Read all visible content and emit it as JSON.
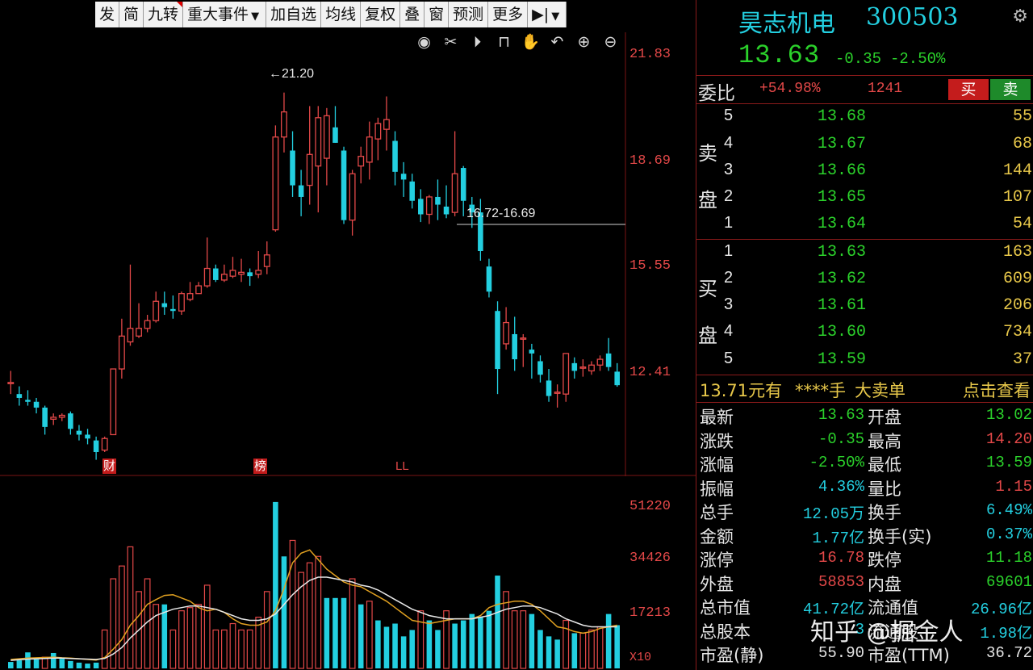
{
  "toolbar": {
    "buttons": [
      "发",
      "简",
      "九转",
      "重大事件",
      "加自选",
      "均线",
      "复权",
      "叠",
      "窗",
      "预测",
      "更多"
    ]
  },
  "icons": [
    "eye-icon",
    "scissors-icon",
    "play-circle-icon",
    "lock-icon",
    "hand-icon",
    "undo-icon",
    "zoom-in-icon",
    "zoom-out-icon"
  ],
  "kline": {
    "price_axis": [
      "21.83",
      "18.69",
      "15.55",
      "12.41"
    ],
    "high_annotation": "21.20",
    "gap_annotation": "16.72-16.69",
    "markers": {
      "cai": "财",
      "bang": "榜",
      "ll": "LL"
    }
  },
  "volume": {
    "axis": [
      "51220",
      "34426",
      "17213"
    ],
    "unit": "X10"
  },
  "quote": {
    "name": "昊志机电",
    "code": "300503",
    "price": "13.63",
    "change": "-0.35",
    "change_pct": "-2.50%",
    "ratio_label": "委比",
    "ratio_pct": "+54.98%",
    "ratio_diff": "1241",
    "buy_label": "买",
    "sell_label": "卖",
    "sell_side_label": [
      "卖",
      "盘"
    ],
    "buy_side_label": [
      "买",
      "盘"
    ],
    "asks": [
      {
        "level": "5",
        "price": "13.68",
        "vol": "55"
      },
      {
        "level": "4",
        "price": "13.67",
        "vol": "68"
      },
      {
        "level": "3",
        "price": "13.66",
        "vol": "144"
      },
      {
        "level": "2",
        "price": "13.65",
        "vol": "107"
      },
      {
        "level": "1",
        "price": "13.64",
        "vol": "54"
      }
    ],
    "bids": [
      {
        "level": "1",
        "price": "13.63",
        "vol": "163"
      },
      {
        "level": "2",
        "price": "13.62",
        "vol": "609"
      },
      {
        "level": "3",
        "price": "13.61",
        "vol": "206"
      },
      {
        "level": "4",
        "price": "13.60",
        "vol": "734"
      },
      {
        "level": "5",
        "price": "13.59",
        "vol": "37"
      }
    ],
    "big_order": {
      "price": "13.71元有",
      "hands": "****手",
      "label": "大卖单",
      "link": "点击查看"
    },
    "stats": [
      {
        "l1": "最新",
        "v1": "13.63",
        "c1": "green",
        "l2": "开盘",
        "v2": "13.02",
        "c2": "green"
      },
      {
        "l1": "涨跌",
        "v1": "-0.35",
        "c1": "green",
        "l2": "最高",
        "v2": "14.20",
        "c2": "red"
      },
      {
        "l1": "涨幅",
        "v1": "-2.50%",
        "c1": "green",
        "l2": "最低",
        "v2": "13.59",
        "c2": "green"
      },
      {
        "l1": "振幅",
        "v1": "4.36%",
        "c1": "cyan",
        "l2": "量比",
        "v2": "1.15",
        "c2": "red"
      },
      {
        "l1": "总手",
        "v1": "12.05万",
        "c1": "cyan",
        "l2": "换手",
        "v2": "6.49%",
        "c2": "cyan"
      },
      {
        "l1": "金额",
        "v1": "1.77亿",
        "c1": "cyan",
        "l2": "换手(实)",
        "v2": "0.37%",
        "c2": "cyan"
      },
      {
        "l1": "涨停",
        "v1": "16.78",
        "c1": "red",
        "l2": "跌停",
        "v2": "11.18",
        "c2": "green"
      },
      {
        "l1": "外盘",
        "v1": "58853",
        "c1": "red",
        "l2": "内盘",
        "v2": "69601",
        "c2": "green"
      },
      {
        "l1": "总市值",
        "v1": "41.72亿",
        "c1": "cyan",
        "l2": "流通值",
        "v2": "26.96亿",
        "c2": "cyan"
      },
      {
        "l1": "总股本",
        "v1": "3",
        "c1": "cyan",
        "l2": "流通股",
        "v2": "1.98亿",
        "c2": "cyan"
      },
      {
        "l1": "市盈(静)",
        "v1": "55.90",
        "c1": "white",
        "l2": "市盈(TTM)",
        "v2": "36.72",
        "c2": "white"
      }
    ]
  },
  "watermark": "知乎 @掘金人",
  "colors": {
    "up": "#e34848",
    "down": "#23cfe0",
    "price": "#2bd12b",
    "accent": "#e8c84a"
  },
  "chart_data": {
    "type": "candlestick",
    "title": "",
    "ylim": [
      11.9,
      22.3
    ],
    "candles": [
      {
        "o": 13.7,
        "c": 13.7,
        "h": 14.0,
        "l": 13.4
      },
      {
        "o": 13.4,
        "c": 13.3,
        "h": 13.6,
        "l": 13.1
      },
      {
        "o": 13.25,
        "c": 13.2,
        "h": 13.5,
        "l": 13.1
      },
      {
        "o": 13.2,
        "c": 13.05,
        "h": 13.3,
        "l": 12.9
      },
      {
        "o": 13.05,
        "c": 12.55,
        "h": 13.1,
        "l": 12.35
      },
      {
        "o": 12.75,
        "c": 12.8,
        "h": 12.9,
        "l": 12.6
      },
      {
        "o": 12.8,
        "c": 12.85,
        "h": 12.9,
        "l": 12.7
      },
      {
        "o": 12.9,
        "c": 12.5,
        "h": 12.95,
        "l": 12.35
      },
      {
        "o": 12.45,
        "c": 12.35,
        "h": 12.6,
        "l": 12.2
      },
      {
        "o": 12.35,
        "c": 12.25,
        "h": 12.5,
        "l": 12.1
      },
      {
        "o": 12.2,
        "c": 11.9,
        "h": 12.3,
        "l": 11.7
      },
      {
        "o": 11.95,
        "c": 12.25,
        "h": 12.3,
        "l": 11.9
      },
      {
        "o": 12.35,
        "c": 14.05,
        "h": 14.05,
        "l": 12.35
      },
      {
        "o": 14.05,
        "c": 14.9,
        "h": 15.35,
        "l": 13.8
      },
      {
        "o": 14.75,
        "c": 15.1,
        "h": 16.75,
        "l": 14.65
      },
      {
        "o": 14.9,
        "c": 15.1,
        "h": 15.75,
        "l": 14.85
      },
      {
        "o": 15.1,
        "c": 15.3,
        "h": 15.45,
        "l": 15.0
      },
      {
        "o": 15.3,
        "c": 15.8,
        "h": 16.05,
        "l": 15.25
      },
      {
        "o": 15.75,
        "c": 15.65,
        "h": 16.05,
        "l": 15.45
      },
      {
        "o": 15.6,
        "c": 15.55,
        "h": 15.95,
        "l": 15.35
      },
      {
        "o": 15.55,
        "c": 16.0,
        "h": 16.05,
        "l": 15.45
      },
      {
        "o": 15.85,
        "c": 16.0,
        "h": 16.3,
        "l": 15.8
      },
      {
        "o": 16.0,
        "c": 16.2,
        "h": 16.3,
        "l": 16.0
      },
      {
        "o": 16.2,
        "c": 16.65,
        "h": 17.45,
        "l": 16.15
      },
      {
        "o": 16.65,
        "c": 16.35,
        "h": 16.75,
        "l": 16.3
      },
      {
        "o": 16.35,
        "c": 16.5,
        "h": 16.75,
        "l": 16.3
      },
      {
        "o": 16.45,
        "c": 16.6,
        "h": 16.95,
        "l": 16.4
      },
      {
        "o": 16.5,
        "c": 16.55,
        "h": 16.9,
        "l": 16.3
      },
      {
        "o": 16.55,
        "c": 16.45,
        "h": 16.65,
        "l": 16.2
      },
      {
        "o": 16.5,
        "c": 16.6,
        "h": 17.1,
        "l": 16.4
      },
      {
        "o": 16.7,
        "c": 17.0,
        "h": 17.35,
        "l": 16.5
      },
      {
        "o": 17.65,
        "c": 20.05,
        "h": 20.35,
        "l": 17.6
      },
      {
        "o": 20.05,
        "c": 20.7,
        "h": 21.2,
        "l": 19.65
      },
      {
        "o": 19.7,
        "c": 18.8,
        "h": 20.2,
        "l": 18.5
      },
      {
        "o": 18.8,
        "c": 18.5,
        "h": 19.2,
        "l": 18.0
      },
      {
        "o": 18.8,
        "c": 19.6,
        "h": 20.85,
        "l": 18.3
      },
      {
        "o": 19.3,
        "c": 20.55,
        "h": 20.85,
        "l": 18.1
      },
      {
        "o": 19.5,
        "c": 20.6,
        "h": 20.8,
        "l": 18.8
      },
      {
        "o": 20.3,
        "c": 19.9,
        "h": 20.85,
        "l": 19.9
      },
      {
        "o": 19.7,
        "c": 17.9,
        "h": 19.8,
        "l": 17.8
      },
      {
        "o": 17.9,
        "c": 19.1,
        "h": 19.2,
        "l": 17.5
      },
      {
        "o": 19.3,
        "c": 19.55,
        "h": 19.8,
        "l": 18.85
      },
      {
        "o": 19.4,
        "c": 20.05,
        "h": 20.45,
        "l": 18.95
      },
      {
        "o": 20.0,
        "c": 20.4,
        "h": 20.55,
        "l": 19.45
      },
      {
        "o": 20.25,
        "c": 20.5,
        "h": 21.1,
        "l": 19.7
      },
      {
        "o": 19.95,
        "c": 19.15,
        "h": 20.2,
        "l": 18.8
      },
      {
        "o": 19.1,
        "c": 18.95,
        "h": 19.4,
        "l": 18.5
      },
      {
        "o": 18.9,
        "c": 18.4,
        "h": 19.1,
        "l": 18.2
      },
      {
        "o": 18.45,
        "c": 18.05,
        "h": 18.7,
        "l": 17.85
      },
      {
        "o": 18.05,
        "c": 18.5,
        "h": 18.55,
        "l": 17.8
      },
      {
        "o": 18.5,
        "c": 18.3,
        "h": 18.95,
        "l": 17.9
      },
      {
        "o": 18.25,
        "c": 18.05,
        "h": 18.8,
        "l": 17.95
      },
      {
        "o": 18.1,
        "c": 19.1,
        "h": 20.2,
        "l": 18.0
      },
      {
        "o": 19.25,
        "c": 18.4,
        "h": 19.3,
        "l": 18.0
      },
      {
        "o": 18.3,
        "c": 18.1,
        "h": 18.5,
        "l": 17.7
      },
      {
        "o": 18.1,
        "c": 17.1,
        "h": 18.45,
        "l": 16.85
      },
      {
        "o": 16.7,
        "c": 16.05,
        "h": 16.9,
        "l": 15.9
      },
      {
        "o": 15.55,
        "c": 14.05,
        "h": 15.8,
        "l": 13.4
      },
      {
        "o": 14.7,
        "c": 15.25,
        "h": 15.65,
        "l": 14.55
      },
      {
        "o": 14.95,
        "c": 14.3,
        "h": 15.4,
        "l": 14.0
      },
      {
        "o": 14.85,
        "c": 14.85,
        "h": 14.95,
        "l": 14.1
      },
      {
        "o": 14.55,
        "c": 14.45,
        "h": 14.7,
        "l": 13.8
      },
      {
        "o": 14.25,
        "c": 13.9,
        "h": 14.4,
        "l": 13.7
      },
      {
        "o": 13.75,
        "c": 13.35,
        "h": 14.05,
        "l": 13.2
      },
      {
        "o": 13.45,
        "c": 13.45,
        "h": 13.65,
        "l": 13.05
      },
      {
        "o": 13.4,
        "c": 14.45,
        "h": 14.45,
        "l": 13.2
      },
      {
        "o": 14.2,
        "c": 14.0,
        "h": 14.35,
        "l": 13.8
      },
      {
        "o": 14.1,
        "c": 14.1,
        "h": 14.3,
        "l": 13.85
      },
      {
        "o": 14.0,
        "c": 14.15,
        "h": 14.25,
        "l": 13.9
      },
      {
        "o": 14.15,
        "c": 14.3,
        "h": 14.4,
        "l": 14.0
      },
      {
        "o": 14.45,
        "c": 14.1,
        "h": 14.85,
        "l": 14.0
      },
      {
        "o": 13.98,
        "c": 13.63,
        "h": 14.2,
        "l": 13.59
      }
    ],
    "volume_ylim": [
      0,
      55000
    ],
    "volumes": [
      {
        "v": 2000,
        "up": false
      },
      {
        "v": 2500,
        "up": false
      },
      {
        "v": 5000,
        "up": false
      },
      {
        "v": 2800,
        "up": false
      },
      {
        "v": 3500,
        "up": true
      },
      {
        "v": 4800,
        "up": false
      },
      {
        "v": 3000,
        "up": false
      },
      {
        "v": 2300,
        "up": false
      },
      {
        "v": 1800,
        "up": false
      },
      {
        "v": 1500,
        "up": false
      },
      {
        "v": 1800,
        "up": false
      },
      {
        "v": 12000,
        "up": true
      },
      {
        "v": 28000,
        "up": true
      },
      {
        "v": 32000,
        "up": true
      },
      {
        "v": 38000,
        "up": true
      },
      {
        "v": 24000,
        "up": true
      },
      {
        "v": 28000,
        "up": true
      },
      {
        "v": 20000,
        "up": true
      },
      {
        "v": 20000,
        "up": false
      },
      {
        "v": 12000,
        "up": true
      },
      {
        "v": 18000,
        "up": true
      },
      {
        "v": 19000,
        "up": true
      },
      {
        "v": 20000,
        "up": true
      },
      {
        "v": 26000,
        "up": true
      },
      {
        "v": 12000,
        "up": true
      },
      {
        "v": 12000,
        "up": true
      },
      {
        "v": 14000,
        "up": true
      },
      {
        "v": 12000,
        "up": true
      },
      {
        "v": 12000,
        "up": true
      },
      {
        "v": 16000,
        "up": true
      },
      {
        "v": 24000,
        "up": true
      },
      {
        "v": 52000,
        "up": false
      },
      {
        "v": 35000,
        "up": false
      },
      {
        "v": 40000,
        "up": true
      },
      {
        "v": 30000,
        "up": true
      },
      {
        "v": 33000,
        "up": true
      },
      {
        "v": 35000,
        "up": true
      },
      {
        "v": 22000,
        "up": false
      },
      {
        "v": 22000,
        "up": false
      },
      {
        "v": 22000,
        "up": false
      },
      {
        "v": 28000,
        "up": true
      },
      {
        "v": 20000,
        "up": false
      },
      {
        "v": 21000,
        "up": true
      },
      {
        "v": 15000,
        "up": false
      },
      {
        "v": 13000,
        "up": false
      },
      {
        "v": 14000,
        "up": false
      },
      {
        "v": 10000,
        "up": false
      },
      {
        "v": 12000,
        "up": false
      },
      {
        "v": 18000,
        "up": true
      },
      {
        "v": 15000,
        "up": false
      },
      {
        "v": 12000,
        "up": false
      },
      {
        "v": 18000,
        "up": true
      },
      {
        "v": 14000,
        "up": false
      },
      {
        "v": 15000,
        "up": false
      },
      {
        "v": 17000,
        "up": false
      },
      {
        "v": 16000,
        "up": false
      },
      {
        "v": 18000,
        "up": false
      },
      {
        "v": 29000,
        "up": false
      },
      {
        "v": 24000,
        "up": true
      },
      {
        "v": 18000,
        "up": true
      },
      {
        "v": 18000,
        "up": true
      },
      {
        "v": 17000,
        "up": false
      },
      {
        "v": 12000,
        "up": false
      },
      {
        "v": 10000,
        "up": false
      },
      {
        "v": 9000,
        "up": false
      },
      {
        "v": 15000,
        "up": true
      },
      {
        "v": 11000,
        "up": false
      },
      {
        "v": 11000,
        "up": true
      },
      {
        "v": 12000,
        "up": true
      },
      {
        "v": 13000,
        "up": true
      },
      {
        "v": 17000,
        "up": false
      },
      {
        "v": 13500,
        "up": false
      }
    ],
    "ma_series": [
      {
        "values": [
          2800,
          3000,
          3200,
          3300,
          3400,
          3500,
          3300,
          3200,
          3000,
          2800,
          2600,
          3400,
          6000,
          9000,
          13500,
          16500,
          20000,
          21500,
          22800,
          23000,
          22000,
          21000,
          19000,
          18000,
          18500,
          17500,
          15500,
          14000,
          13500,
          13500,
          14500,
          18000,
          25000,
          33000,
          36000,
          37000,
          34000,
          31000,
          29000,
          27000,
          26000,
          25500,
          24000,
          22500,
          21000,
          19000,
          17000,
          15000,
          14500,
          14000,
          14500,
          15000,
          15500,
          15500,
          15500,
          16500,
          19000,
          20000,
          20500,
          21000,
          21000,
          20000,
          18000,
          15500,
          13000,
          12500,
          11500,
          11000,
          11500,
          12500,
          13000,
          13500
        ]
      },
      {
        "values": [
          2500,
          2700,
          2900,
          3000,
          3100,
          3200,
          3200,
          3100,
          3000,
          2900,
          2800,
          3100,
          4500,
          6500,
          9500,
          12000,
          14500,
          16500,
          17500,
          18500,
          19000,
          19500,
          19500,
          19000,
          18500,
          17500,
          16500,
          15500,
          15000,
          15000,
          15500,
          17000,
          20000,
          23000,
          25500,
          27500,
          28500,
          28500,
          28000,
          27500,
          27000,
          26000,
          25500,
          24500,
          23000,
          21500,
          20000,
          18500,
          17500,
          16500,
          16000,
          15500,
          15500,
          15500,
          15500,
          16000,
          16500,
          17500,
          18500,
          19000,
          19500,
          19500,
          19000,
          18000,
          17000,
          15500,
          14500,
          13500,
          13000,
          13000,
          13000,
          13000
        ]
      }
    ]
  }
}
